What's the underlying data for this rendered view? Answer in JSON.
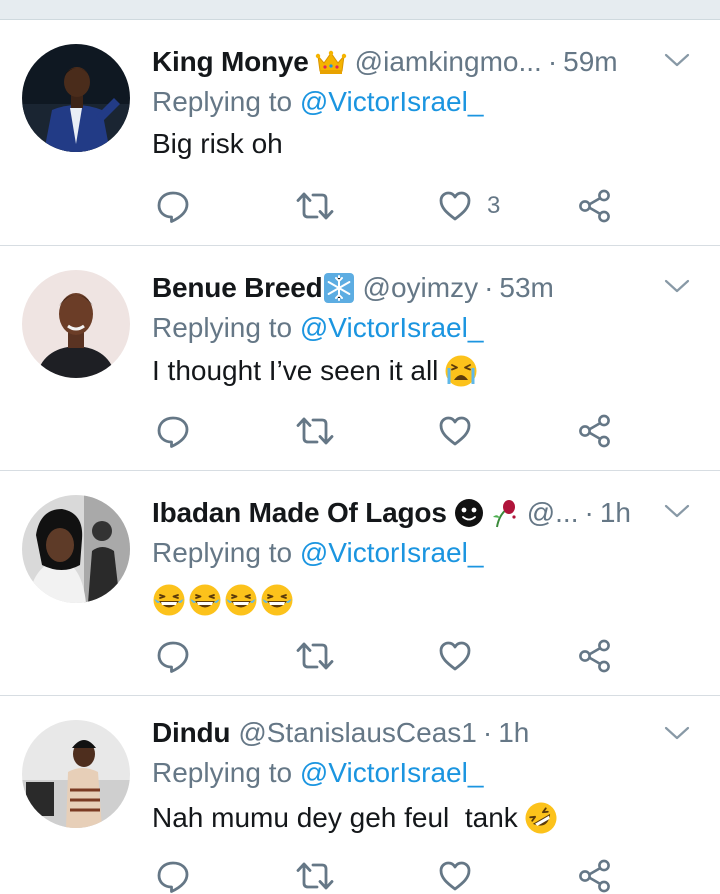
{
  "tweets": [
    {
      "name": "King Monye",
      "badge_icon": "crown-icon",
      "handle": "@iamkingmo...",
      "time": "59m",
      "replying_prefix": "Replying to",
      "replying_mention": "@VictorIsrael_",
      "text": "Big risk oh",
      "emojis": [],
      "like_count": "3"
    },
    {
      "name": "Benue Breed",
      "badge_icon": "snowflake-icon",
      "handle": "@oyimzy",
      "time": "53m",
      "replying_prefix": "Replying to",
      "replying_mention": "@VictorIsrael_",
      "text": "I thought I’ve seen it all",
      "emojis": [
        "crying-face-emoji"
      ],
      "like_count": ""
    },
    {
      "name": "Ibadan Made Of Lagos",
      "badge_icon": "black-face-emoji",
      "badge_icon_2": "wilted-rose-emoji",
      "handle": "@...",
      "time": "1h",
      "replying_prefix": "Replying to",
      "replying_mention": "@VictorIsrael_",
      "text": "",
      "emojis": [
        "laughing-emoji",
        "laughing-emoji",
        "laughing-emoji",
        "laughing-emoji"
      ],
      "like_count": ""
    },
    {
      "name": "Dindu",
      "badge_icon": "",
      "handle": "@StanislausCeas1",
      "time": "1h",
      "replying_prefix": "Replying to",
      "replying_mention": "@VictorIsrael_",
      "text": "Nah mumu dey geh feul  tank",
      "emojis": [
        "rofl-emoji"
      ],
      "like_count": ""
    }
  ],
  "icons": {
    "reply": "reply-icon",
    "retweet": "retweet-icon",
    "like": "heart-icon",
    "share": "share-icon",
    "menu": "chevron-down-icon"
  },
  "colors": {
    "link": "#1b95e0",
    "secondary_text": "#657786",
    "primary_text": "#14171a",
    "divider": "#d7dde2",
    "emoji_yellow": "#fcc21b"
  }
}
